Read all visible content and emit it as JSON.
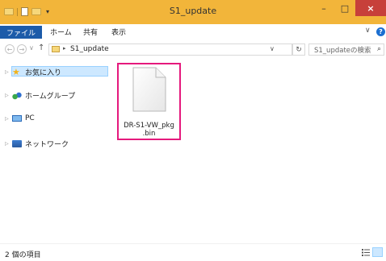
{
  "window": {
    "title": "S1_update",
    "minimize_glyph": "–",
    "maximize_glyph": "□",
    "close_glyph": "×"
  },
  "quick_access": {
    "dropdown_glyph": "▾"
  },
  "ribbon": {
    "tabs": [
      "ファイル",
      "ホーム",
      "共有",
      "表示"
    ],
    "expand_glyph": "∨",
    "help_glyph": "?"
  },
  "address": {
    "back_glyph": "←",
    "forward_glyph": "→",
    "recent_glyph": "∨",
    "up_glyph": "↑",
    "separator_glyph": "▸",
    "path": "S1_update",
    "dropdown_glyph": "∨",
    "refresh_glyph": "↻",
    "search_placeholder": "S1_updateの検索",
    "search_glyph": "⌕"
  },
  "nav_pane": {
    "items": [
      {
        "label": "お気に入り",
        "icon": "star-icon",
        "selected": true
      },
      {
        "label": "ホームグループ",
        "icon": "homegroup-icon",
        "selected": false
      },
      {
        "label": "PC",
        "icon": "computer-icon",
        "selected": false
      },
      {
        "label": "ネットワーク",
        "icon": "network-icon",
        "selected": false
      }
    ],
    "expand_glyph": "▷"
  },
  "content": {
    "file": {
      "name_line1": "DR-S1-VW_pkg",
      "name_line2": ".bin",
      "icon": "document-icon"
    },
    "highlight_color": "#e5197d"
  },
  "status": {
    "item_count": "2 個の項目"
  },
  "colors": {
    "titlebar": "#f2b53a",
    "file_tab": "#1c5ba9",
    "close": "#c7403a",
    "selection": "#cde8ff"
  }
}
